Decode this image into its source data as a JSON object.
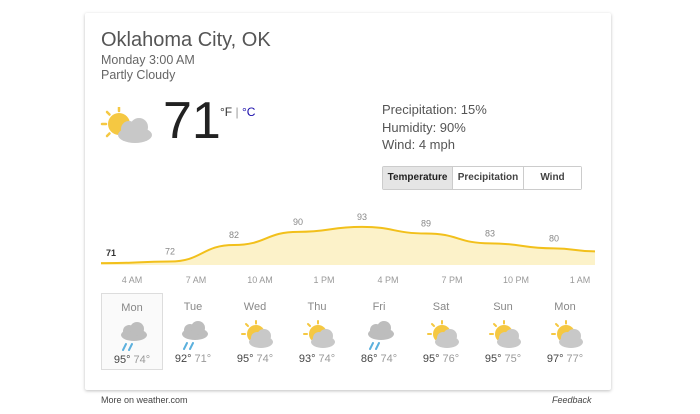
{
  "location": "Oklahoma City, OK",
  "datetime": "Monday 3:00 AM",
  "condition": "Partly Cloudy",
  "current": {
    "temp": "71",
    "unit_f": "°F",
    "unit_sep": "|",
    "unit_c": "°C",
    "icon": "partly-cloudy-icon"
  },
  "details": {
    "precipitation": "Precipitation: 15%",
    "humidity": "Humidity: 90%",
    "wind": "Wind: 4 mph"
  },
  "tabs": [
    {
      "label": "Temperature",
      "active": true
    },
    {
      "label": "Precipitation",
      "active": false
    },
    {
      "label": "Wind",
      "active": false
    }
  ],
  "chart_data": {
    "type": "area",
    "x": [
      "4 AM",
      "7 AM",
      "10 AM",
      "1 PM",
      "4 PM",
      "7 PM",
      "10 PM",
      "1 AM"
    ],
    "values": [
      71,
      72,
      82,
      90,
      93,
      89,
      83,
      80
    ],
    "title": "",
    "xlabel": "",
    "ylabel": ""
  },
  "colors": {
    "line": "#f2c01b",
    "fill": "#fcf2c9",
    "sun": "#f5c842",
    "cloud": "#c8c8c8",
    "rain": "#5bb0dd",
    "link": "#1a0dab"
  },
  "forecast": [
    {
      "day": "Mon",
      "hi": "95°",
      "lo": "74°",
      "icon": "rain-icon"
    },
    {
      "day": "Tue",
      "hi": "92°",
      "lo": "71°",
      "icon": "rain-icon"
    },
    {
      "day": "Wed",
      "hi": "95°",
      "lo": "74°",
      "icon": "partly-cloudy-icon"
    },
    {
      "day": "Thu",
      "hi": "93°",
      "lo": "74°",
      "icon": "partly-cloudy-icon"
    },
    {
      "day": "Fri",
      "hi": "86°",
      "lo": "74°",
      "icon": "rain-icon"
    },
    {
      "day": "Sat",
      "hi": "95°",
      "lo": "76°",
      "icon": "partly-cloudy-icon"
    },
    {
      "day": "Sun",
      "hi": "95°",
      "lo": "75°",
      "icon": "partly-cloudy-icon"
    },
    {
      "day": "Mon",
      "hi": "97°",
      "lo": "77°",
      "icon": "partly-cloudy-icon"
    }
  ],
  "footer": {
    "source": "More on weather.com",
    "feedback": "Feedback"
  }
}
